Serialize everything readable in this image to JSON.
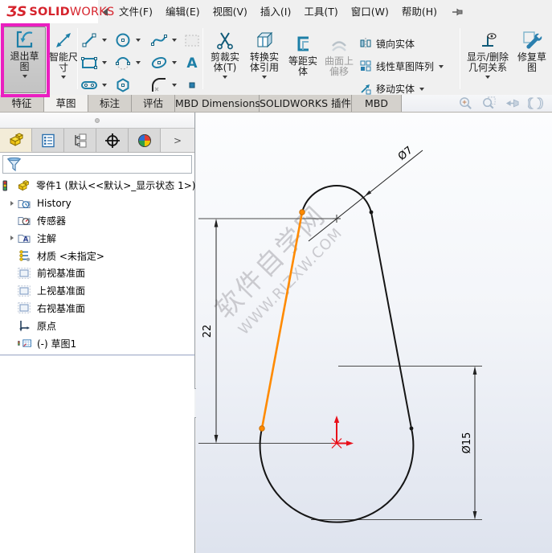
{
  "titlebar": {
    "logo": {
      "mark": "ƷS",
      "brand_bold": "SOLID",
      "brand_light": "WORKS"
    },
    "menus": [
      {
        "label": "文件(F)"
      },
      {
        "label": "编辑(E)"
      },
      {
        "label": "视图(V)"
      },
      {
        "label": "插入(I)"
      },
      {
        "label": "工具(T)"
      },
      {
        "label": "窗口(W)"
      },
      {
        "label": "帮助(H)"
      }
    ]
  },
  "ribbon": {
    "exit_sketch": "退出草图",
    "smart_dimension": "智能尺寸",
    "trim": "剪裁实体(T)",
    "convert": "转换实体引用",
    "offset": "等距实体",
    "surface_offset": "曲面上偏移",
    "mirror": "镜向实体",
    "linear_pattern": "线性草图阵列",
    "move": "移动实体",
    "relations": "显示/删除几何关系",
    "repair": "修复草图"
  },
  "tabbar": {
    "tabs": [
      {
        "label": "特征"
      },
      {
        "label": "草图",
        "active": true
      },
      {
        "label": "标注"
      },
      {
        "label": "评估"
      },
      {
        "label": "MBD Dimensions"
      },
      {
        "label": "SOLIDWORKS 插件"
      },
      {
        "label": "MBD"
      }
    ]
  },
  "panel": {
    "tabs_overflow": ">",
    "root_label": "零件1 (默认<<默认>_显示状态 1>)",
    "items": [
      {
        "label": "History",
        "expandable": true,
        "icon": "folder-history"
      },
      {
        "label": "传感器",
        "expandable": false,
        "icon": "folder-sensors"
      },
      {
        "label": "注解",
        "expandable": true,
        "icon": "folder-annotations"
      },
      {
        "label": "材质 <未指定>",
        "expandable": false,
        "icon": "material"
      },
      {
        "label": "前视基准面",
        "expandable": false,
        "icon": "plane"
      },
      {
        "label": "上视基准面",
        "expandable": false,
        "icon": "plane"
      },
      {
        "label": "右视基准面",
        "expandable": false,
        "icon": "plane"
      },
      {
        "label": "原点",
        "expandable": false,
        "icon": "origin"
      },
      {
        "label": "(-) 草图1",
        "expandable": false,
        "icon": "sketch"
      }
    ]
  },
  "sketch": {
    "dimensions": {
      "top_diameter": "Ø7",
      "left_height": "22",
      "bottom_diameter": "Ø15"
    },
    "dimension_values": {
      "top_diameter": 7,
      "left_height": 22,
      "bottom_diameter": 15
    },
    "watermark": {
      "line1": "软件自学网",
      "line2": "WWW.RJZXW.COM"
    },
    "colors": {
      "selected_entity": "#ff8a00",
      "entity": "#151515",
      "origin_triad": "#e8101a",
      "highlight_box": "#ea1fc0"
    }
  }
}
